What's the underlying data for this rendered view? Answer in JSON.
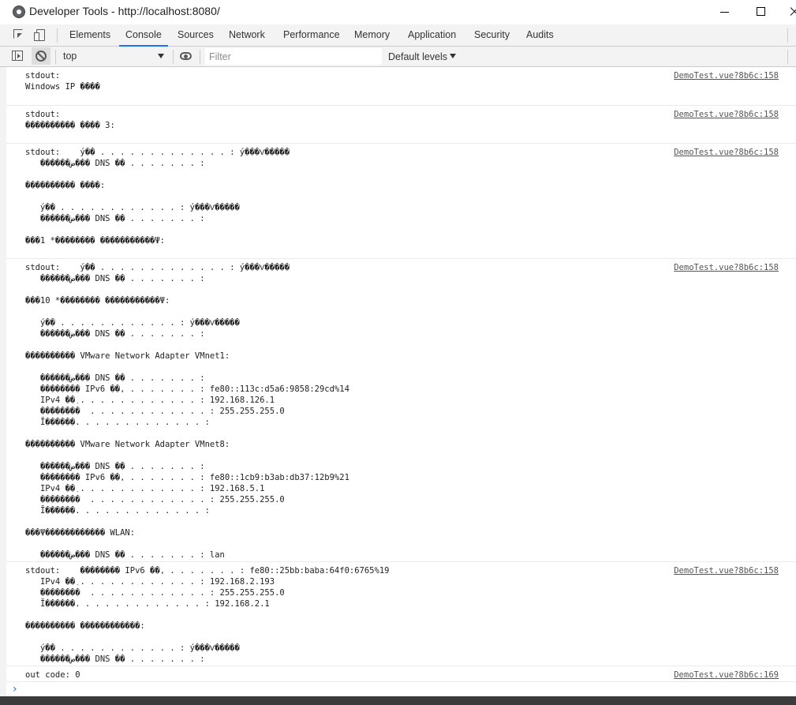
{
  "window": {
    "title": "Developer Tools - http://localhost:8080/"
  },
  "tabs": [
    {
      "label": "Elements",
      "active": false
    },
    {
      "label": "Console",
      "active": true
    },
    {
      "label": "Sources",
      "active": false
    },
    {
      "label": "Network",
      "active": false
    },
    {
      "label": "Performance",
      "active": false
    },
    {
      "label": "Memory",
      "active": false
    },
    {
      "label": "Application",
      "active": false
    },
    {
      "label": "Security",
      "active": false
    },
    {
      "label": "Audits",
      "active": false
    }
  ],
  "toolbar": {
    "context": "top",
    "filter_placeholder": "Filter",
    "levels_label": "Default levels"
  },
  "messages": [
    {
      "text": "stdout:\nWindows IP ����",
      "link": "DemoTest.vue?8b6c:158"
    },
    {
      "text": "stdout:\n���������� ���� 3:",
      "link": "DemoTest.vue?8b6c:158"
    },
    {
      "text": "stdout:    ý��׺ . . . . . . . . . . . . . : ý���Ѵ�����\n   ������ض��� DNS ��׺ . . . . . . . :\n\n���������� ����:\n\n   ý��׺ . . . . . . . . . . . . : ý���Ѵ�����\n   ������ض��� DNS ��׺ . . . . . . . :\n\n���1 *�������� �����������Ψ:",
      "link": "DemoTest.vue?8b6c:158"
    },
    {
      "text": "stdout:    ý��׺ . . . . . . . . . . . . . : ý���Ѵ�����\n   ������ض��� DNS ��׺ . . . . . . . :\n\n���10 *�������� �����������Ψ:\n\n   ý��׺ . . . . . . . . . . . . : ý���Ѵ�����\n   ������ض��� DNS ��׺ . . . . . . . :\n\n���������� VMware Network Adapter VMnet1:\n\n   ������ض��� DNS ��׺ . . . . . . . :\n   �������� IPv6 ��ַ. . . . . . . . : fe80::113c:d5a6:9858:29cd%14\n   IPv4 ��ַ . . . . . . . . . . . . : 192.168.126.1\n   ��������  . . . . . . . . . . . . : 255.255.255.0\n   Ĭ������. . . . . . . . . . . . . :\n\n���������� VMware Network Adapter VMnet8:\n\n   ������ض��� DNS ��׺ . . . . . . . :\n   �������� IPv6 ��ַ. . . . . . . . : fe80::1cb9:b3ab:db37:12b9%21\n   IPv4 ��ַ . . . . . . . . . . . . : 192.168.5.1\n   ��������  . . . . . . . . . . . . : 255.255.255.0\n   Ĭ������. . . . . . . . . . . . . :\n\n���Ψ������������ WLAN:\n\n   ������ض��� DNS ��׺ . . . . . . . : lan",
      "link": "DemoTest.vue?8b6c:158"
    },
    {
      "text": "stdout:    �������� IPv6 ��ַ. . . . . . . . : fe80::25bb:baba:64f0:6765%19\n   IPv4 ��ַ . . . . . . . . . . . . : 192.168.2.193\n   ��������  . . . . . . . . . . . . : 255.255.255.0\n   Ĭ������. . . . . . . . . . . . . : 192.168.2.1\n\n���������� ������������:\n\n   ý��׺ . . . . . . . . . . . . : ý���Ѵ�����\n   ������ض��� DNS ��׺ . . . . . . . :",
      "link": "DemoTest.vue?8b6c:158"
    },
    {
      "text": "out code: 0",
      "link": "DemoTest.vue?8b6c:169"
    }
  ],
  "prompt": {
    "symbol": "›"
  }
}
